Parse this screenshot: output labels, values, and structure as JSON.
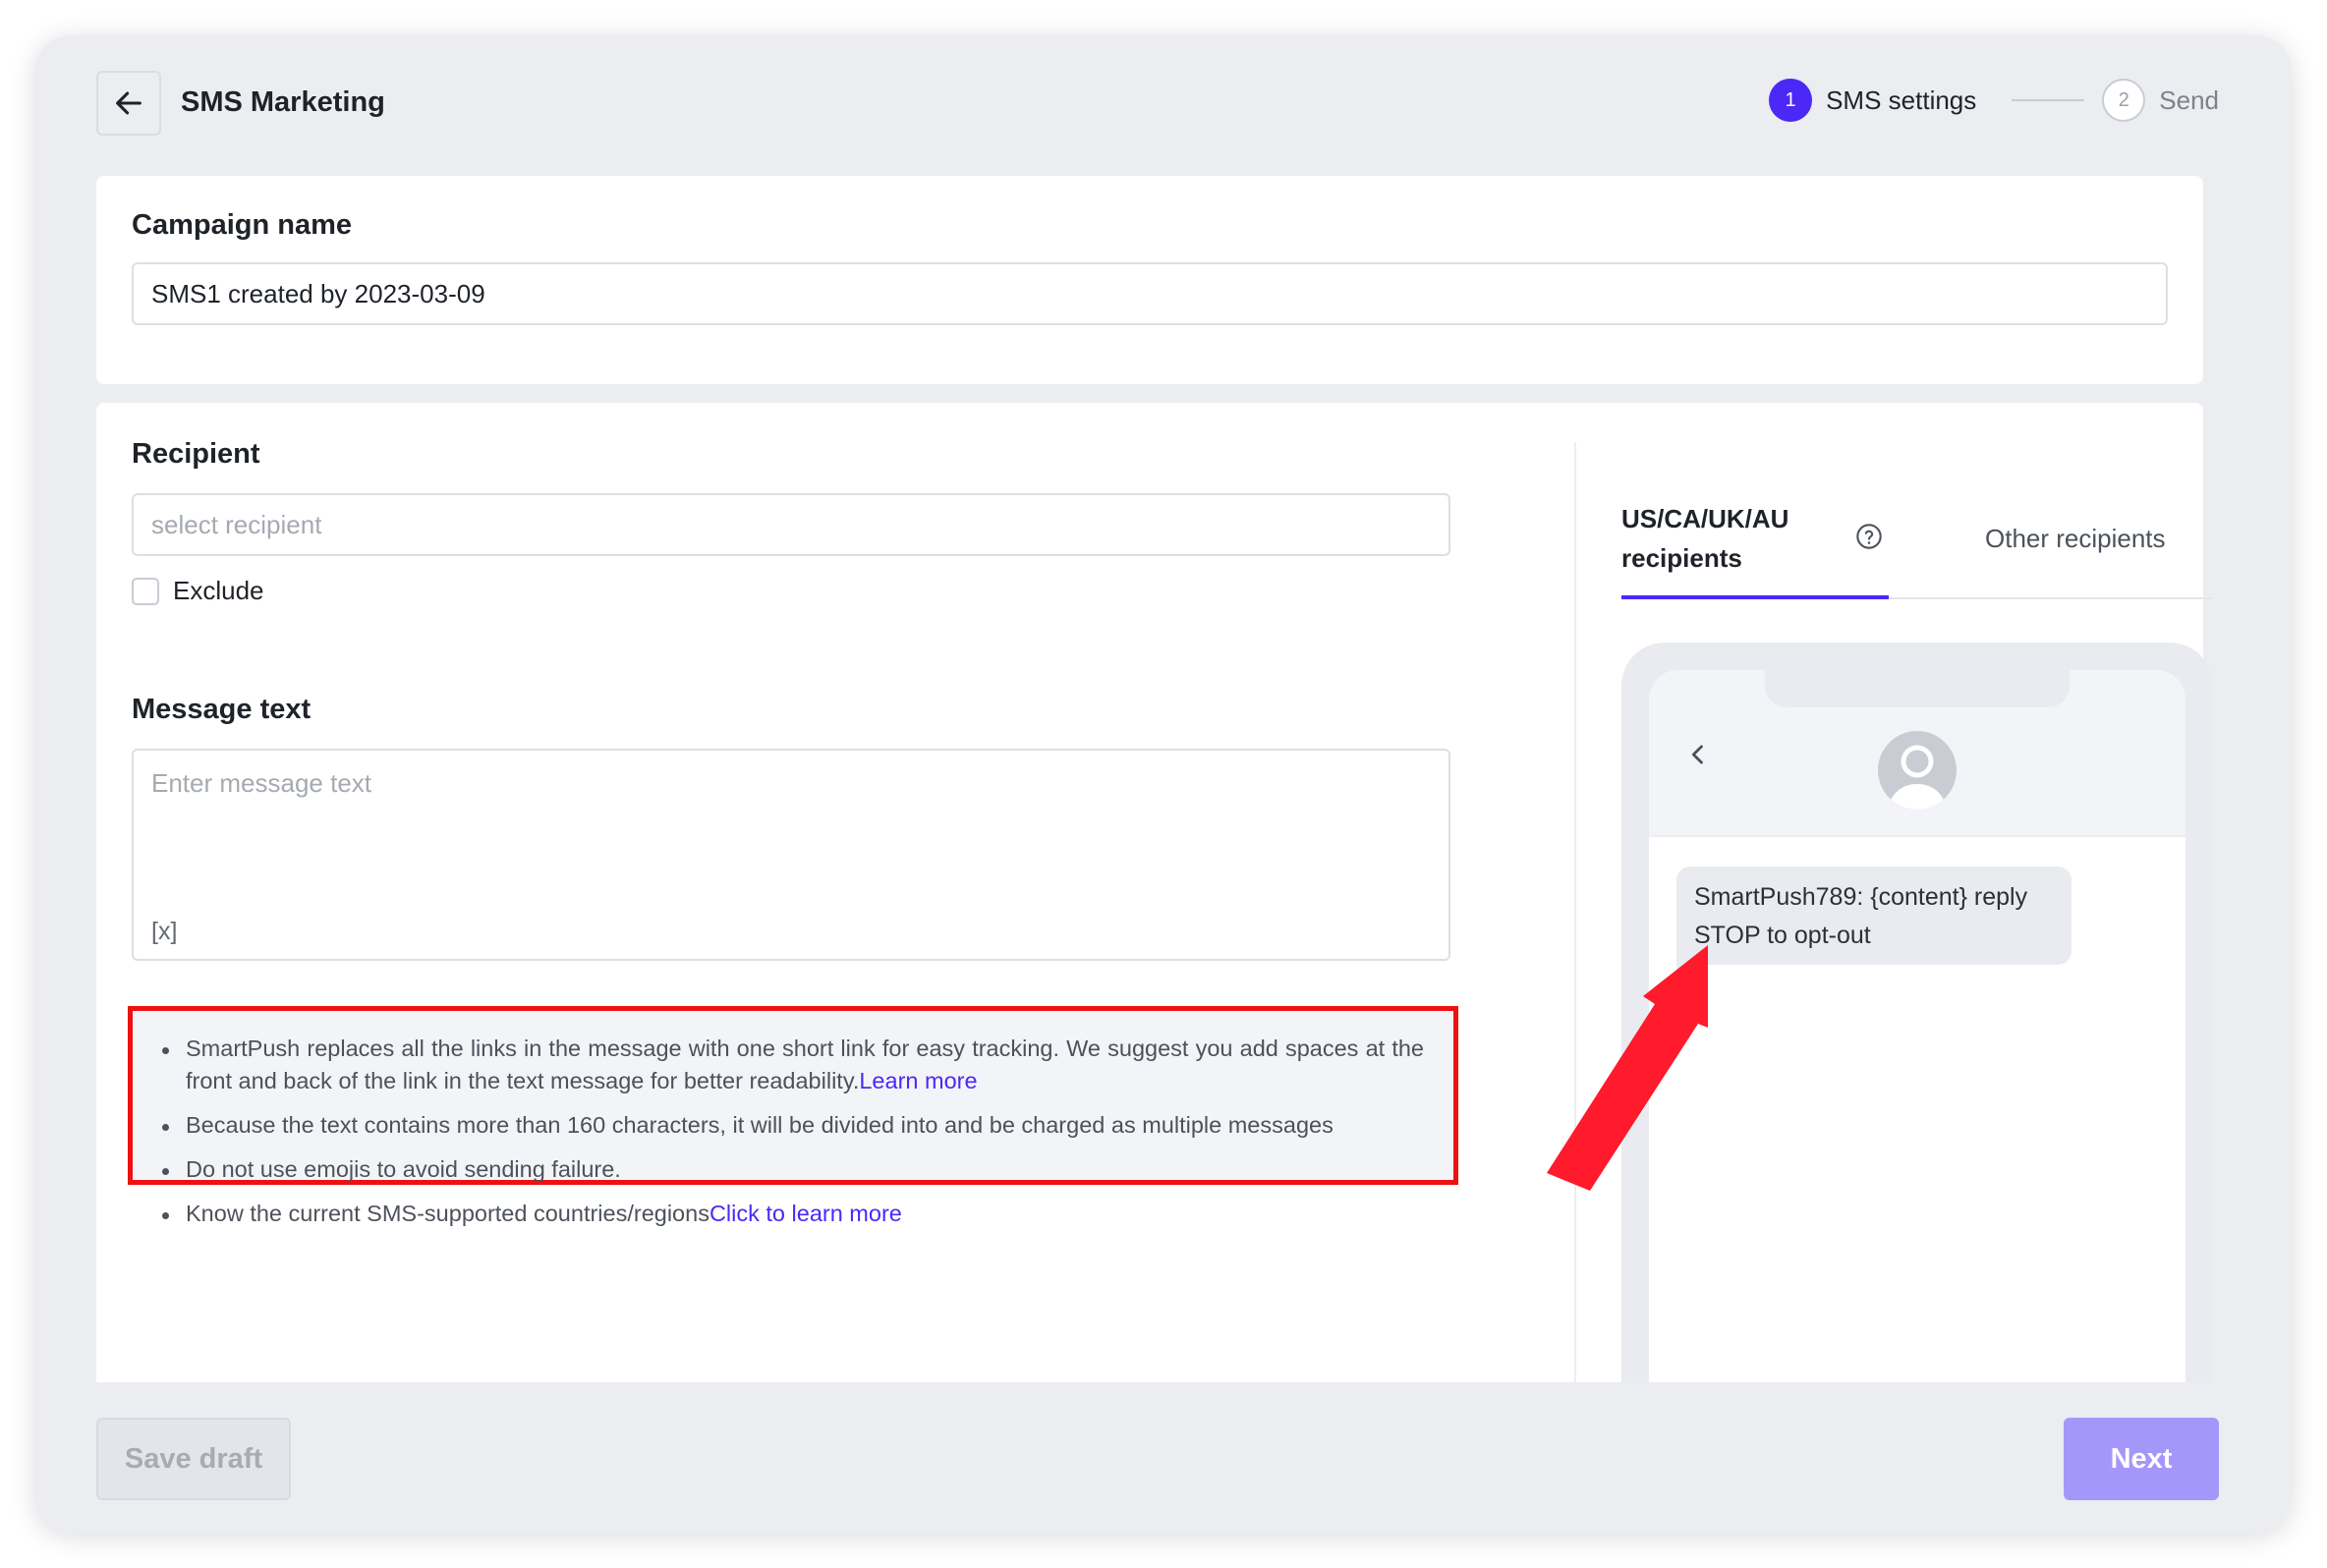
{
  "header": {
    "title": "SMS Marketing",
    "steps": [
      {
        "number": "1",
        "label": "SMS settings",
        "state": "active"
      },
      {
        "number": "2",
        "label": "Send",
        "state": "inactive"
      }
    ]
  },
  "campaign": {
    "label": "Campaign name",
    "value": "SMS1 created by 2023-03-09"
  },
  "recipient": {
    "label": "Recipient",
    "placeholder": "select recipient",
    "exclude_label": "Exclude"
  },
  "message": {
    "label": "Message text",
    "placeholder": "Enter message text",
    "variable_button": "[x]"
  },
  "notes": {
    "items": [
      {
        "text": "SmartPush replaces all the links in the message with one short link for easy tracking. We suggest you add spaces at the front and back of the link in the text message for better readability.",
        "link": "Learn more"
      },
      {
        "text": "Because the text contains more than 160 characters, it will be divided into and be charged as multiple messages",
        "link": ""
      },
      {
        "text": "Do not use emojis to avoid sending failure.",
        "link": ""
      },
      {
        "text": "Know the current SMS-supported countries/regions",
        "link": "Click to learn more"
      }
    ]
  },
  "preview": {
    "tabs": [
      {
        "label": "US/CA/UK/AU recipients",
        "state": "active"
      },
      {
        "label": "Other recipients",
        "state": "inactive"
      }
    ],
    "bubble_text": "SmartPush789: {content} reply STOP to opt-out"
  },
  "footer": {
    "save_draft": "Save draft",
    "next": "Next"
  },
  "colors": {
    "accent": "#4b28f5",
    "next_button": "#a597fa",
    "highlight_border": "#ee1111",
    "annotation_arrow": "#ff1a2c"
  },
  "icons": {
    "back": "arrow-left-icon",
    "help": "question-circle-icon",
    "phone_back": "chevron-left-icon",
    "avatar": "user-avatar-icon"
  }
}
